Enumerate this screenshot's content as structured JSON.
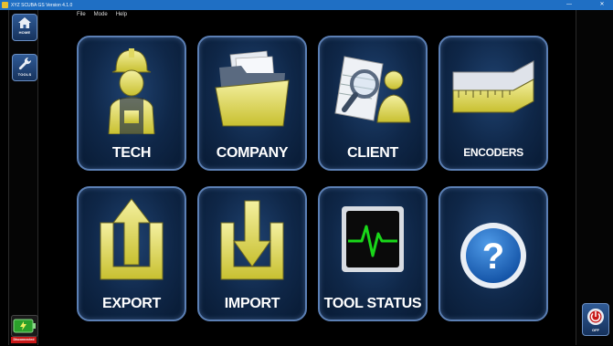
{
  "window": {
    "title": "XYZ SCUBA GS Version 4.1.0",
    "minimize": "—",
    "close": "✕"
  },
  "menu": {
    "items": [
      "File",
      "Mode",
      "Help"
    ]
  },
  "sidebar": {
    "home_label": "HOME",
    "tools_label": "TOOLS",
    "status_label": "Disconnected"
  },
  "right_bar": {
    "off_label": "OFF"
  },
  "tiles": [
    {
      "label": "TECH",
      "icon": "technician-icon"
    },
    {
      "label": "COMPANY",
      "icon": "folder-icon"
    },
    {
      "label": "CLIENT",
      "icon": "client-search-icon"
    },
    {
      "label": "ENCODERS",
      "icon": "ruler-icon"
    },
    {
      "label": "EXPORT",
      "icon": "export-arrow-icon"
    },
    {
      "label": "IMPORT",
      "icon": "import-arrow-icon"
    },
    {
      "label": "TOOL STATUS",
      "icon": "heartbeat-monitor-icon"
    },
    {
      "label": "?",
      "icon": "help-icon"
    }
  ],
  "colors": {
    "accent": "#1f6fc4",
    "tile_border": "#5b7fb4",
    "icon_yellow": "#e8e07a",
    "status_red": "#c81818",
    "pulse_green": "#19d619"
  }
}
